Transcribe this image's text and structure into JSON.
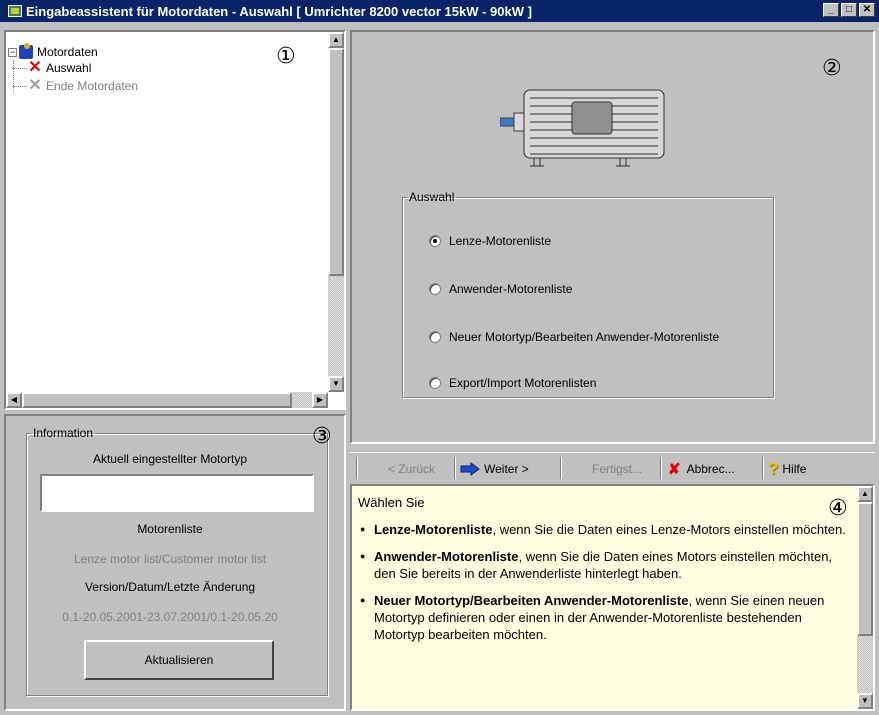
{
  "window": {
    "title": "Eingabeassistent für Motordaten - Auswahl  [ Umrichter 8200 vector 15kW - 90kW  ]",
    "minimize": "_",
    "maximize": "□",
    "close": "✕"
  },
  "markers": {
    "one": "①",
    "two": "②",
    "three": "③",
    "four": "④"
  },
  "tree": {
    "root_label": "Motordaten",
    "expander": "−",
    "items": [
      {
        "label": "Auswahl",
        "icon": "red-x-icon"
      },
      {
        "label": "Ende Motordaten",
        "icon": "gray-x-icon"
      }
    ]
  },
  "info": {
    "legend": "Information",
    "current_motor_label": "Aktuell eingestellter Motortyp",
    "current_motor_value": "",
    "motor_list_label": "Motorenliste",
    "motor_list_value": "Lenze motor list/Customer motor list",
    "version_label": "Version/Datum/Letzte Änderung",
    "version_value": "0.1-20.05.2001-23.07.2001/0.1-20.05.20",
    "refresh_button": "Aktualisieren"
  },
  "selection": {
    "legend": "Auswahl",
    "options": [
      {
        "label": "Lenze-Motorenliste",
        "checked": true
      },
      {
        "label": "Anwender-Motorenliste",
        "checked": false
      },
      {
        "label": "Neuer Motortyp/Bearbeiten Anwender-Motorenliste",
        "checked": false
      },
      {
        "label": "Export/Import Motorenlisten",
        "checked": false
      }
    ]
  },
  "toolbar": {
    "back": "< Zurück",
    "next": "Weiter >",
    "finish": "Fertigst...",
    "cancel": "Abbrec...",
    "help": "Hilfe"
  },
  "help": {
    "intro": "Wählen Sie",
    "items": [
      {
        "bold": "Lenze-Motorenliste",
        "text": ", wenn Sie die Daten eines Lenze-Motors einstellen möchten."
      },
      {
        "bold": "Anwender-Motorenliste",
        "text": ", wenn Sie die Daten eines Motors einstellen möchten, den Sie bereits in der Anwenderliste hinterlegt haben."
      },
      {
        "bold": "Neuer Motortyp/Bearbeiten Anwender-Motorenliste",
        "text": ", wenn Sie einen neuen Motortyp definieren oder einen in der Anwender-Motorenliste bestehenden Motortyp bearbeiten möchten."
      }
    ]
  }
}
